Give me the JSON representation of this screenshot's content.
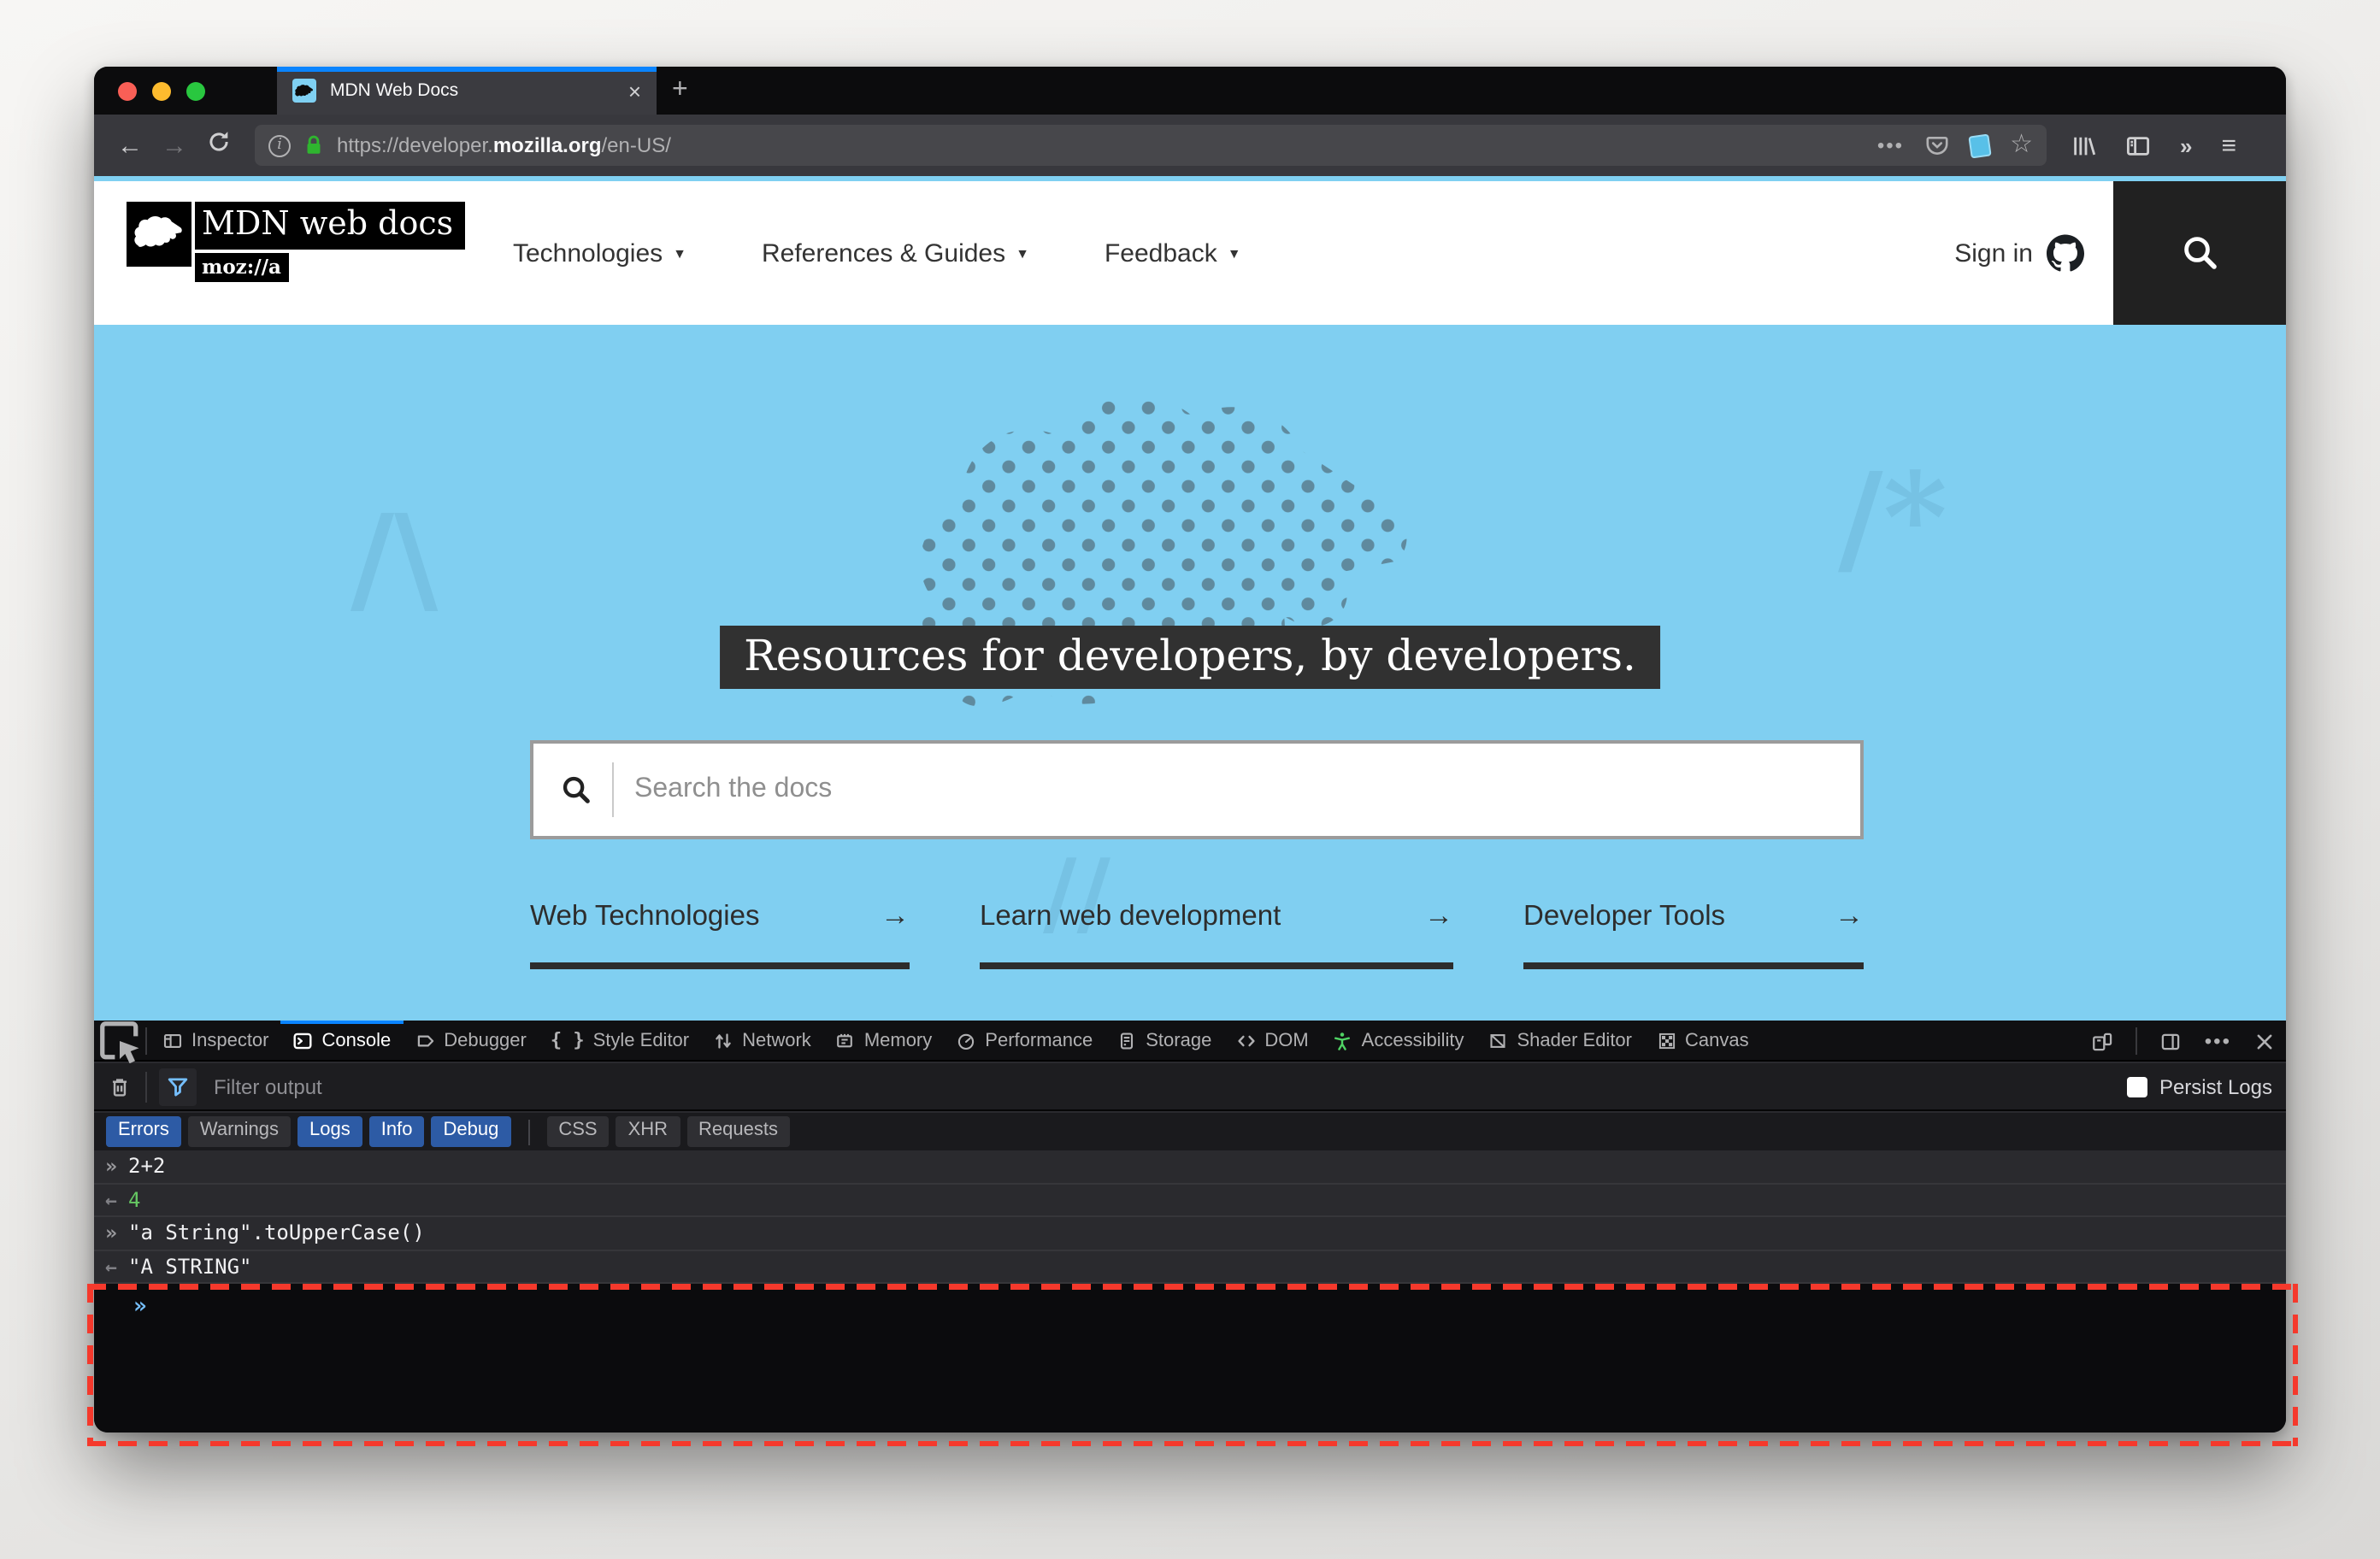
{
  "browser": {
    "tab": {
      "title": "MDN Web Docs"
    },
    "address": {
      "prefix": "https://developer.",
      "domain": "mozilla.org",
      "path": "/en-US/"
    }
  },
  "icons": {
    "back": "←",
    "forward": "→",
    "new_tab": "+",
    "tab_close": "×",
    "overflow_dots": "•••",
    "more_chevrons": "»",
    "menu": "≡",
    "bookmark_star": "☆",
    "style_editor_braces": "{ }",
    "nav_caret": "▼",
    "arrow_right": "→",
    "info": "i"
  },
  "mdn_header": {
    "logo_title": "MDN web docs",
    "logo_sub": "moz://a",
    "nav": [
      {
        "label": "Technologies"
      },
      {
        "label": "References & Guides"
      },
      {
        "label": "Feedback"
      }
    ],
    "sign_in": "Sign in"
  },
  "hero": {
    "title": "Resources for developers, by developers.",
    "search_placeholder": "Search the docs",
    "links": [
      {
        "label": "Web Technologies"
      },
      {
        "label": "Learn web development"
      },
      {
        "label": "Developer Tools"
      }
    ]
  },
  "devtools": {
    "tabs": [
      {
        "label": "Inspector"
      },
      {
        "label": "Console",
        "active": true
      },
      {
        "label": "Debugger"
      },
      {
        "label": "Style Editor"
      },
      {
        "label": "Network"
      },
      {
        "label": "Memory"
      },
      {
        "label": "Performance"
      },
      {
        "label": "Storage"
      },
      {
        "label": "DOM"
      },
      {
        "label": "Accessibility"
      },
      {
        "label": "Shader Editor"
      },
      {
        "label": "Canvas"
      }
    ],
    "filter_placeholder": "Filter output",
    "persist_logs_label": "Persist Logs",
    "filter_buttons_left": [
      {
        "label": "Errors",
        "active": true
      },
      {
        "label": "Warnings",
        "active": false
      },
      {
        "label": "Logs",
        "active": true
      },
      {
        "label": "Info",
        "active": true
      },
      {
        "label": "Debug",
        "active": true
      }
    ],
    "filter_buttons_right": [
      {
        "label": "CSS",
        "active": false
      },
      {
        "label": "XHR",
        "active": false
      },
      {
        "label": "Requests",
        "active": false
      }
    ],
    "console": {
      "rows": [
        {
          "prefix": "»",
          "text": "2+2",
          "is_result": false
        },
        {
          "prefix": "←",
          "text": "4",
          "is_result": true,
          "color": "#65c763"
        },
        {
          "prefix": "»",
          "text": "\"a String\".toUpperCase()",
          "is_result": false,
          "marked": true
        },
        {
          "prefix": "←",
          "text": "\"A STRING\"",
          "is_result": true
        }
      ],
      "prompt": "»"
    }
  },
  "colors": {
    "accent_blue": "#0a84ff",
    "hero_blue": "#80cff1",
    "active_filter_blue": "#2d5ba5",
    "prompt_blue": "#75bfff",
    "result_green": "#65c763",
    "highlight_red": "#f5392c",
    "accessibility_green": "#4fd364"
  }
}
